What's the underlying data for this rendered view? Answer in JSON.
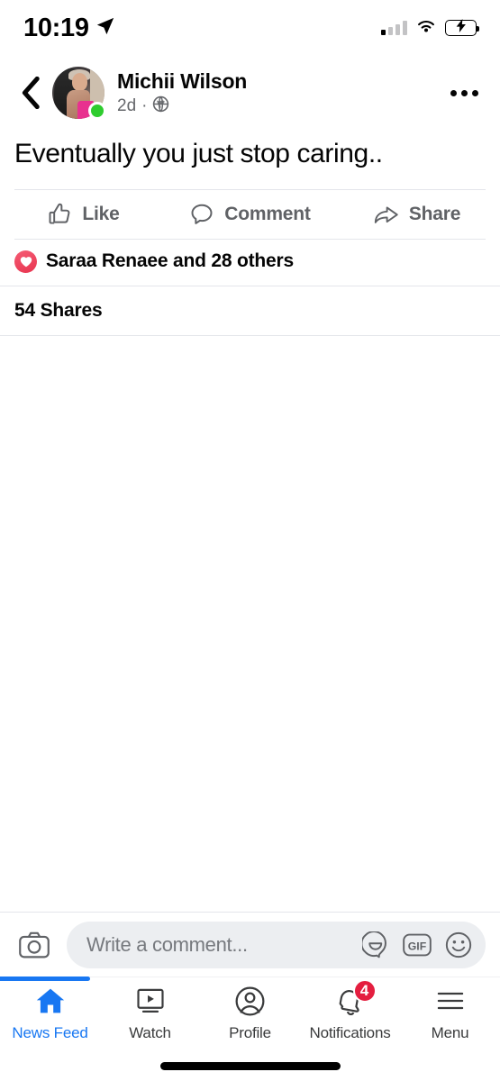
{
  "status_bar": {
    "time": "10:19",
    "location_icon": "location-arrow-icon",
    "signal_icon": "cellular-signal-icon",
    "wifi_icon": "wifi-icon",
    "battery_icon": "battery-charging-icon",
    "battery_color": "#34c759"
  },
  "post_header": {
    "back_icon": "chevron-left-icon",
    "avatar_label": "avatar",
    "online_status": "online",
    "online_color": "#2ecc2e",
    "author": "Michii Wilson",
    "timestamp": "2d",
    "separator": "·",
    "privacy_icon": "globe-icon",
    "more_icon": "ellipsis-icon"
  },
  "post": {
    "text": "Eventually you just stop caring..",
    "actions": [
      {
        "label": "Like",
        "icon": "thumbs-up-icon"
      },
      {
        "label": "Comment",
        "icon": "comment-bubble-icon"
      },
      {
        "label": "Share",
        "icon": "share-arrow-icon"
      }
    ],
    "reactions": {
      "icon": "heart-reaction-icon",
      "color": "#e8344f",
      "text": "Saraa Renaee and 28 others"
    },
    "shares": "54 Shares"
  },
  "comment_bar": {
    "camera_icon": "camera-icon",
    "placeholder": "Write a comment...",
    "sticker_icon": "sticker-icon",
    "gif_icon": "gif-icon",
    "gif_label": "GIF",
    "emoji_icon": "emoji-smiley-icon"
  },
  "tabbar": {
    "accent_color": "#1877f2",
    "badge_color": "#e41e3f",
    "items": [
      {
        "label": "News Feed",
        "icon": "home-icon",
        "active": true,
        "badge": ""
      },
      {
        "label": "Watch",
        "icon": "video-play-icon",
        "active": false,
        "badge": ""
      },
      {
        "label": "Profile",
        "icon": "person-circle-icon",
        "active": false,
        "badge": ""
      },
      {
        "label": "Notifications",
        "icon": "bell-icon",
        "active": false,
        "badge": "4"
      },
      {
        "label": "Menu",
        "icon": "hamburger-menu-icon",
        "active": false,
        "badge": ""
      }
    ]
  },
  "home_indicator": "home-indicator-bar"
}
